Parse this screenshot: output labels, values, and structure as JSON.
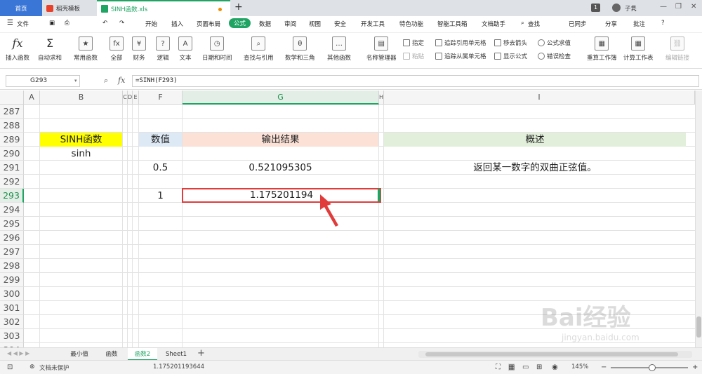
{
  "tabs": {
    "home": "首页",
    "daoke": "稻壳模板",
    "file": "SINH函数.xls",
    "new_tab": "+"
  },
  "window": {
    "user": "子隽",
    "page_badge": "1"
  },
  "menu": {
    "file": "文件",
    "items": [
      "开始",
      "插入",
      "页面布局",
      "公式",
      "数据",
      "审阅",
      "视图",
      "安全",
      "开发工具",
      "特色功能",
      "智能工具箱",
      "文档助手"
    ],
    "search": "查找",
    "sync": "已同步",
    "share": "分享",
    "comment": "批注",
    "help": "?"
  },
  "ribbon": {
    "insert_function": "插入函数",
    "autosum": "自动求和",
    "common_func": "常用函数",
    "all": "全部",
    "finance": "财务",
    "logic": "逻辑",
    "text": "文本",
    "datetime": "日期和时间",
    "lookup": "查找与引用",
    "math": "数学和三角",
    "other": "其他函数",
    "name_mgr": "名称管理器",
    "specify": "指定",
    "paste": "粘贴",
    "trace_prec": "追踪引用单元格",
    "trace_dep": "追踪从属单元格",
    "remove_arrows": "移去箭头",
    "show_formula": "显示公式",
    "eval_formula": "公式求值",
    "error_check": "错误检查",
    "recalc_book": "重算工作簿",
    "calc_sheet": "计算工作表",
    "edit_links": "编辑链接"
  },
  "formula_bar": {
    "name_box": "G293",
    "fx": "fx",
    "formula": "=SINH(F293)"
  },
  "columns": [
    "A",
    "B",
    "C",
    "D",
    "E",
    "F",
    "G",
    "H",
    "I"
  ],
  "rows": [
    "287",
    "288",
    "289",
    "290",
    "291",
    "292",
    "293",
    "294",
    "295",
    "296",
    "297",
    "298",
    "299",
    "300",
    "301",
    "302",
    "303",
    "304"
  ],
  "cells": {
    "b289": "SINH函数",
    "b290": "sinh",
    "f289": "数值",
    "g289": "输出结果",
    "i289": "概述",
    "f291": "0.5",
    "g291": "0.521095305",
    "i291": "返回某一数字的双曲正弦值。",
    "f293": "1",
    "g293": "1.175201194"
  },
  "sheets": [
    "最小值",
    "函数",
    "函数2",
    "Sheet1"
  ],
  "active_sheet": "函数2",
  "status": {
    "protect": "文档未保护",
    "value": "1.175201193644",
    "zoom": "145%"
  },
  "watermark": {
    "brand": "Bai经验",
    "url": "jingyan.baidu.com"
  },
  "colors": {
    "accent_green": "#1fa463",
    "header_yellow": "#ffff00",
    "header_blue": "#dde9f5",
    "header_peach": "#fbe1d6",
    "header_green": "#e2efda",
    "annotation_red": "#e03c3c"
  }
}
